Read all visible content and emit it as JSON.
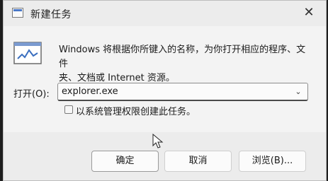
{
  "window": {
    "title": "新建任务"
  },
  "prompt": {
    "description_line1": "Windows 将根据你所键入的名称，为你打开相应的程序、文件",
    "description_line2": "夹、文档或 Internet 资源。"
  },
  "open_field": {
    "label": "打开(O):",
    "value": "explorer.exe"
  },
  "admin_checkbox": {
    "label": "以系统管理权限创建此任务。",
    "checked": false
  },
  "buttons": {
    "ok": "确定",
    "cancel": "取消",
    "browse": "浏览(B)..."
  },
  "icons": {
    "title": "task-manager-icon",
    "close": "close-icon",
    "run": "run-icon",
    "dropdown": "chevron-down-icon",
    "cursor": "mouse-cursor-icon"
  },
  "colors": {
    "dialog_bg": "#efefef",
    "content_bg": "#f3f3f3",
    "footer_bg": "#ececec",
    "accent_icon": "#4a78c8"
  }
}
